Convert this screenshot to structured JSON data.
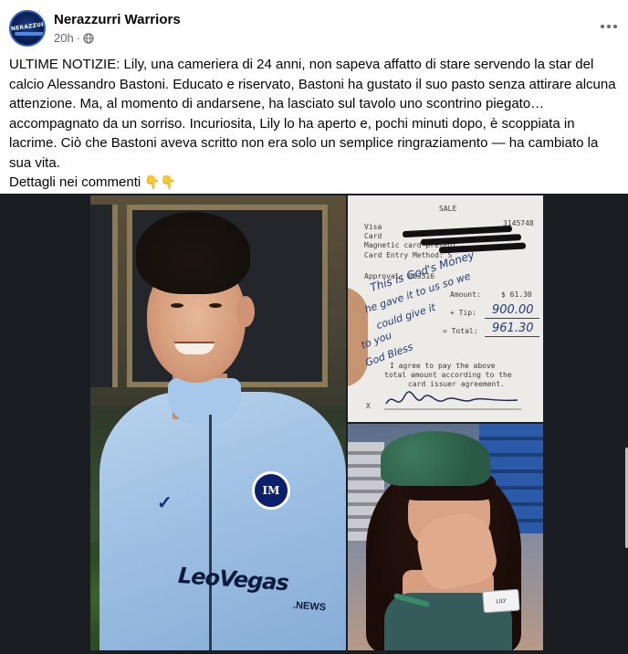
{
  "header": {
    "page_name": "Nerazzurri Warriors",
    "avatar_text": "NERAZZURRI",
    "time": "20h",
    "separator": "·",
    "privacy_icon": "globe-icon",
    "more_icon": "more-options-icon"
  },
  "post": {
    "text": "ULTIME NOTIZIE: Lily, una cameriera di 24 anni, non sapeva affatto di stare servendo la star del calcio Alessandro Bastoni. Educato e riservato, Bastoni ha gustato il suo pasto senza attirare alcuna attenzione. Ma, al momento di andarsene, ha lasciato sul tavolo uno scontrino piegato… accompagnato da un sorriso. Incuriosita, Lily lo ha aperto e, pochi minuti dopo, è scoppiata in lacrime. Ciò che Bastoni aveva scritto non era solo un semplice ringraziamento — ha cambiato la sua vita.",
    "details": "Dettagli nei commenti",
    "details_emoji": "👇👇"
  },
  "media": {
    "player_photo": {
      "crest_text": "IM",
      "sponsor": "LeoVegas",
      "sponsor_sub": ".NEWS"
    },
    "receipt": {
      "sale": "SALE",
      "visa": "Visa",
      "visa_number": "3145748",
      "card": "Card",
      "magnetic": "Magnetic card present",
      "entry": "Card Entry Method: S",
      "approval": "Approval: 063516",
      "amount_label": "Amount:",
      "amount": "$ 61.30",
      "tip_label": "+ Tip:",
      "tip": "900.00",
      "total_label": "= Total:",
      "total": "961.30",
      "agree_1": "I agree to pay the above",
      "agree_2": "total amount according to the",
      "agree_3": "card issuer agreement.",
      "x_mark": "X",
      "note_1": "This is God's Money",
      "note_2": "he gave it to us so we",
      "note_3": "could give it",
      "note_4": "to you",
      "note_5": "God Bless"
    },
    "woman_photo": {
      "tag_text": "LILY"
    }
  }
}
